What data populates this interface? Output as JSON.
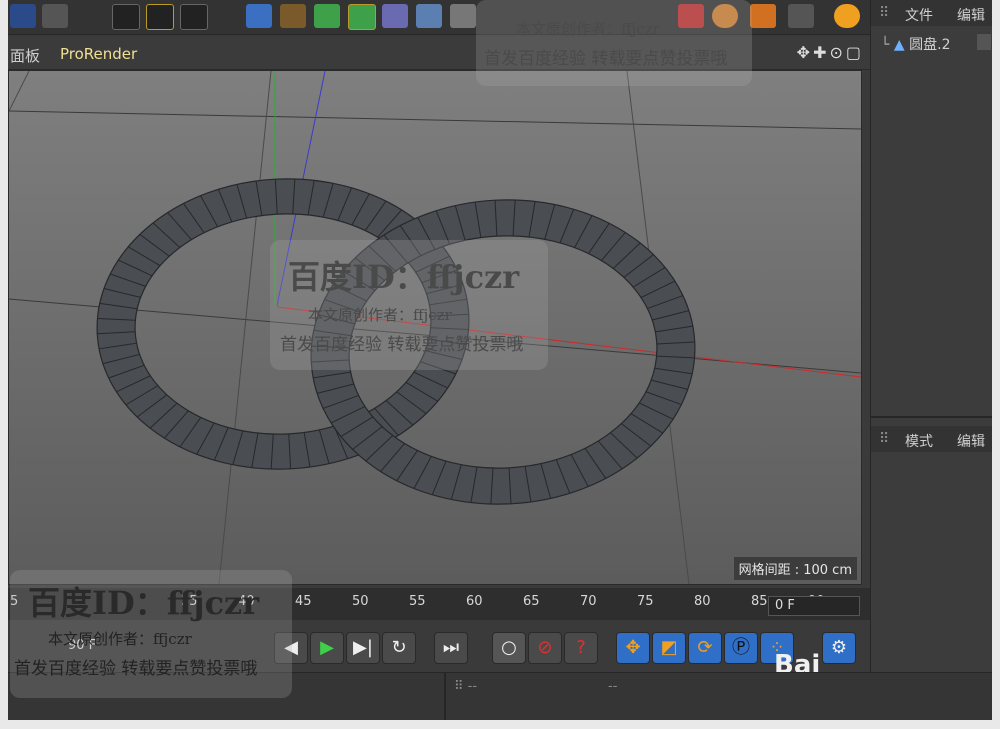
{
  "viewport_menu": {
    "panel": "面板",
    "prorender": "ProRender"
  },
  "grid_spacing": "网格间距 : 100 cm",
  "right_panel": {
    "file": "文件",
    "edit": "编辑",
    "object": "圆盘.2",
    "mode": "模式",
    "edit2": "编辑"
  },
  "timeline": {
    "ticks": [
      "5",
      "",
      "",
      "35",
      "40",
      "45",
      "50",
      "55",
      "60",
      "65",
      "70",
      "75",
      "80",
      "85",
      "90"
    ],
    "current_frame": "0 F",
    "end_frame": "90 F"
  },
  "watermarks": {
    "top_line1": "本文原创作者：ffjczr",
    "top_line2": "首发百度经验 转载要点赞投票哦",
    "center_title": "百度ID：ffjczr",
    "center_line1": "本文原创作者：ffjczr",
    "center_line2": "首发百度经验 转载要点赞投票哦",
    "bottom_title": "百度ID：ffjczr",
    "bottom_line1": "本文原创作者：ffjczr",
    "bottom_line2": "首发百度经验 转载要点赞投票哦"
  },
  "brand": "Bai",
  "colors": {
    "axis_x": "#cc2b2b",
    "axis_y": "#2bb02b",
    "axis_z": "#3a3ad0",
    "ring_fill": "#4a4d52",
    "ring_stroke": "#26282b"
  }
}
